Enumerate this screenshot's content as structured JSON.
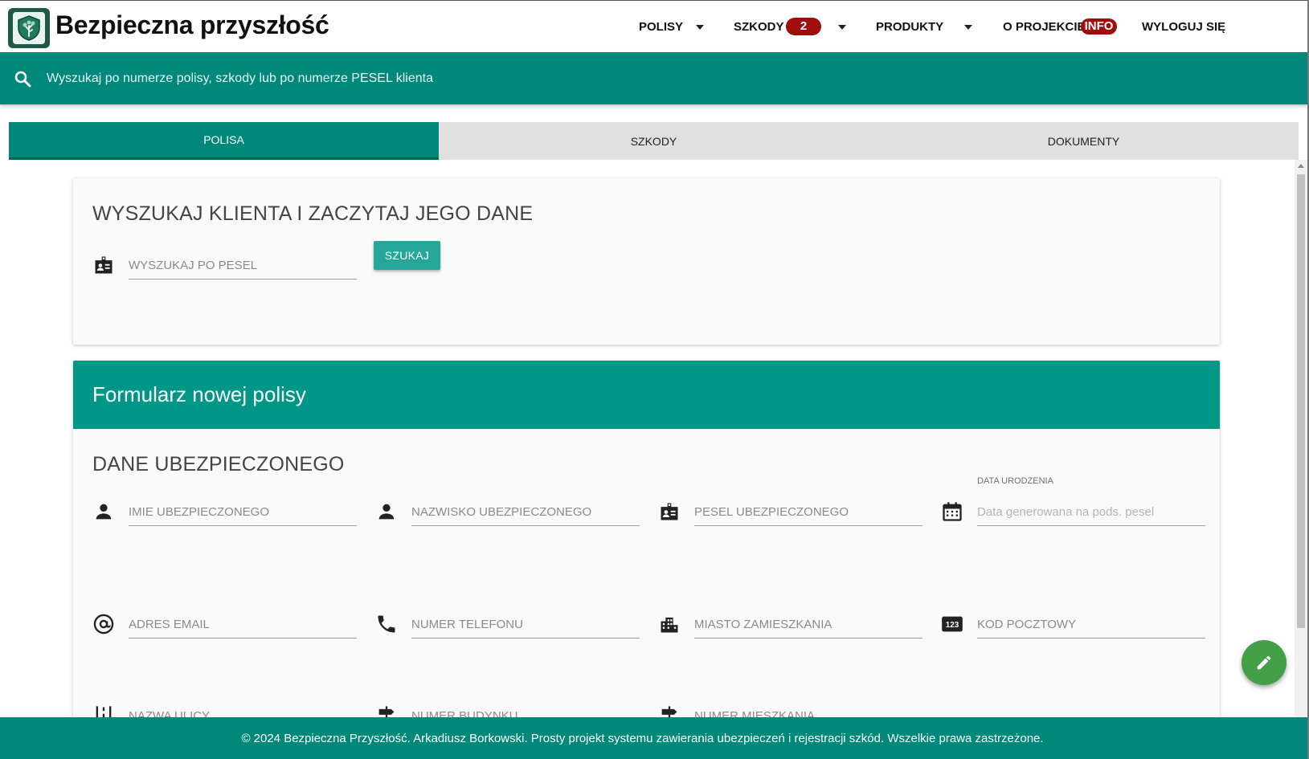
{
  "app": {
    "brand": "Bezpieczna przyszłość"
  },
  "nav": {
    "policies": "POLISY",
    "claims": "SZKODY",
    "claims_badge": "2",
    "products": "PRODUKTY",
    "about": "O PROJEKCIE",
    "about_badge": "INFO",
    "logout": "WYLOGUJ SIĘ"
  },
  "search": {
    "placeholder": "Wyszukaj po numerze polisy, szkody lub po numerze PESEL klienta"
  },
  "tabs": [
    "POLISA",
    "SZKODY",
    "DOKUMENTY"
  ],
  "client_search": {
    "title": "WYSZUKAJ KLIENTA I ZACZYTAJ JEGO DANE",
    "pesel_placeholder": "WYSZUKAJ PO PESEL",
    "button": "SZUKAJ"
  },
  "policy_form": {
    "header": "Formularz nowej polisy",
    "section_title": "DANE UBEZPIECZONEGO",
    "first_name": "IMIE UBEZPIECZONEGO",
    "last_name": "NAZWISKO UBEZPIECZONEGO",
    "pesel": "PESEL UBEZPIECZONEGO",
    "birth_date_label": "DATA URODZENIA",
    "birth_date_placeholder": "Data generowana na pods. pesel",
    "email": "ADRES EMAIL",
    "phone": "NUMER TELEFONU",
    "city": "MIASTO ZAMIESZKANIA",
    "postal_code": "KOD POCZTOWY",
    "street": "NAZWA ULICY",
    "building_number": "NUMER BUDYNKU",
    "apartment_number": "NUMER MIESZKANIA"
  },
  "footer": {
    "text": "© 2024 Bezpieczna Przyszłość. Arkadiusz Borkowski. Prosty projekt systemu zawierania ubezpieczeń i rejestracji szkód. Wszelkie prawa zastrzeżone."
  },
  "colors": {
    "primary": "#00897b",
    "accent": "#26a69a",
    "badge": "#a10d0d",
    "fab": "#43a047"
  }
}
